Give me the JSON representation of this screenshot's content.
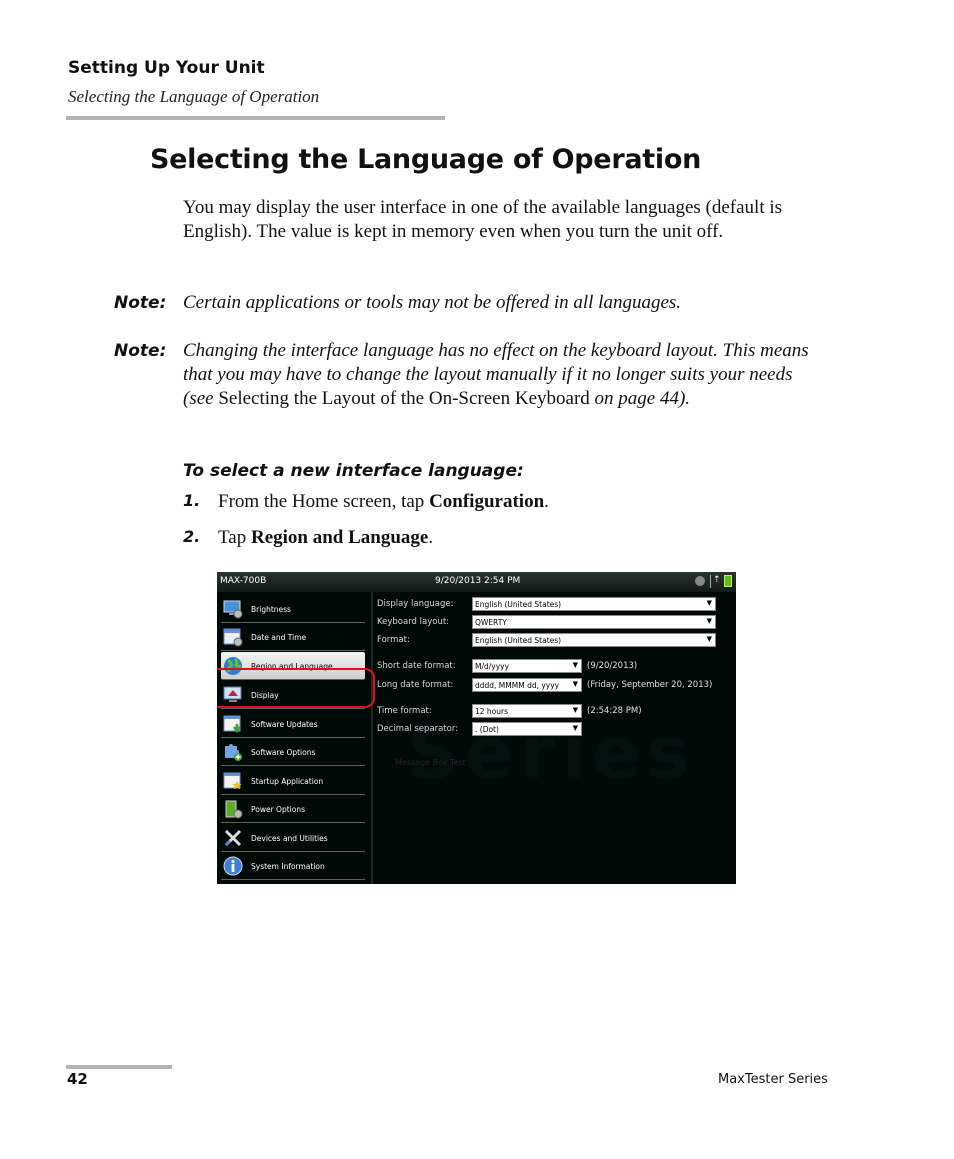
{
  "header": {
    "chapter": "Setting Up Your Unit",
    "section": "Selecting the Language of Operation"
  },
  "title": "Selecting the Language of Operation",
  "intro": "You may display the user interface in one of the available languages (default is English). The value is kept in memory even when you turn the unit off.",
  "notes": [
    {
      "label": "Note:",
      "text": "Certain applications or tools may not be offered in all languages."
    },
    {
      "label": "Note:",
      "text_before": "Changing the interface language has no effect on the keyboard layout. This means that you may have to change the layout manually if it no longer suits your needs (see ",
      "link": "Selecting the Layout of the On-Screen Keyboard",
      "text_after": " on page 44)."
    }
  ],
  "procedure": {
    "title": "To select a new interface language:",
    "steps": [
      {
        "num": "1.",
        "text": "From the Home screen, tap ",
        "bold": "Configuration",
        "end": "."
      },
      {
        "num": "2.",
        "text": "Tap ",
        "bold": "Region and Language",
        "end": "."
      }
    ]
  },
  "screen": {
    "device": "MAX-700B",
    "datetime": "9/20/2013 2:54 PM",
    "status_icons": [
      "bluetooth-icon",
      "power-plug-icon",
      "battery-icon"
    ],
    "sidebar": [
      {
        "label": "Brightness",
        "icon": "monitor-gear-icon"
      },
      {
        "label": "Date and Time",
        "icon": "calendar-gear-icon"
      },
      {
        "label": "Region and Language",
        "icon": "globe-icon",
        "selected": true
      },
      {
        "label": "Display",
        "icon": "display-icon"
      },
      {
        "label": "Software Updates",
        "icon": "window-download-icon"
      },
      {
        "label": "Software Options",
        "icon": "puzzle-plus-icon"
      },
      {
        "label": "Startup Application",
        "icon": "window-star-icon"
      },
      {
        "label": "Power Options",
        "icon": "battery-gear-icon"
      },
      {
        "label": "Devices and Utilities",
        "icon": "tools-icon"
      },
      {
        "label": "System Information",
        "icon": "info-icon"
      }
    ],
    "fields": {
      "display_language": {
        "label": "Display language:",
        "value": "English (United States)"
      },
      "keyboard_layout": {
        "label": "Keyboard layout:",
        "value": "QWERTY"
      },
      "format": {
        "label": "Format:",
        "value": "English (United States)"
      },
      "short_date": {
        "label": "Short date format:",
        "value": "M/d/yyyy",
        "example": "(9/20/2013)"
      },
      "long_date": {
        "label": "Long date format:",
        "value": "dddd, MMMM dd, yyyy",
        "example": "(Friday, September 20, 2013)"
      },
      "time_format": {
        "label": "Time format:",
        "value": "12 hours",
        "example": "(2:54:28 PM)"
      },
      "decimal_separator": {
        "label": "Decimal separator:",
        "value": ". (Dot)"
      }
    },
    "background_ghost_text": "Message Box Test",
    "highlight_color": "#e0101a"
  },
  "footer": {
    "page": "42",
    "series": "MaxTester Series"
  }
}
